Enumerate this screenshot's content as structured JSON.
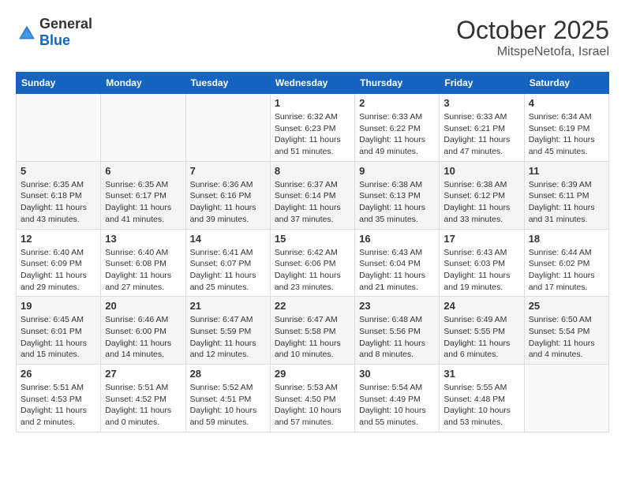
{
  "header": {
    "logo_general": "General",
    "logo_blue": "Blue",
    "month": "October 2025",
    "location": "MitspeNetofa, Israel"
  },
  "weekdays": [
    "Sunday",
    "Monday",
    "Tuesday",
    "Wednesday",
    "Thursday",
    "Friday",
    "Saturday"
  ],
  "weeks": [
    [
      {
        "day": "",
        "info": ""
      },
      {
        "day": "",
        "info": ""
      },
      {
        "day": "",
        "info": ""
      },
      {
        "day": "1",
        "info": "Sunrise: 6:32 AM\nSunset: 6:23 PM\nDaylight: 11 hours and 51 minutes."
      },
      {
        "day": "2",
        "info": "Sunrise: 6:33 AM\nSunset: 6:22 PM\nDaylight: 11 hours and 49 minutes."
      },
      {
        "day": "3",
        "info": "Sunrise: 6:33 AM\nSunset: 6:21 PM\nDaylight: 11 hours and 47 minutes."
      },
      {
        "day": "4",
        "info": "Sunrise: 6:34 AM\nSunset: 6:19 PM\nDaylight: 11 hours and 45 minutes."
      }
    ],
    [
      {
        "day": "5",
        "info": "Sunrise: 6:35 AM\nSunset: 6:18 PM\nDaylight: 11 hours and 43 minutes."
      },
      {
        "day": "6",
        "info": "Sunrise: 6:35 AM\nSunset: 6:17 PM\nDaylight: 11 hours and 41 minutes."
      },
      {
        "day": "7",
        "info": "Sunrise: 6:36 AM\nSunset: 6:16 PM\nDaylight: 11 hours and 39 minutes."
      },
      {
        "day": "8",
        "info": "Sunrise: 6:37 AM\nSunset: 6:14 PM\nDaylight: 11 hours and 37 minutes."
      },
      {
        "day": "9",
        "info": "Sunrise: 6:38 AM\nSunset: 6:13 PM\nDaylight: 11 hours and 35 minutes."
      },
      {
        "day": "10",
        "info": "Sunrise: 6:38 AM\nSunset: 6:12 PM\nDaylight: 11 hours and 33 minutes."
      },
      {
        "day": "11",
        "info": "Sunrise: 6:39 AM\nSunset: 6:11 PM\nDaylight: 11 hours and 31 minutes."
      }
    ],
    [
      {
        "day": "12",
        "info": "Sunrise: 6:40 AM\nSunset: 6:09 PM\nDaylight: 11 hours and 29 minutes."
      },
      {
        "day": "13",
        "info": "Sunrise: 6:40 AM\nSunset: 6:08 PM\nDaylight: 11 hours and 27 minutes."
      },
      {
        "day": "14",
        "info": "Sunrise: 6:41 AM\nSunset: 6:07 PM\nDaylight: 11 hours and 25 minutes."
      },
      {
        "day": "15",
        "info": "Sunrise: 6:42 AM\nSunset: 6:06 PM\nDaylight: 11 hours and 23 minutes."
      },
      {
        "day": "16",
        "info": "Sunrise: 6:43 AM\nSunset: 6:04 PM\nDaylight: 11 hours and 21 minutes."
      },
      {
        "day": "17",
        "info": "Sunrise: 6:43 AM\nSunset: 6:03 PM\nDaylight: 11 hours and 19 minutes."
      },
      {
        "day": "18",
        "info": "Sunrise: 6:44 AM\nSunset: 6:02 PM\nDaylight: 11 hours and 17 minutes."
      }
    ],
    [
      {
        "day": "19",
        "info": "Sunrise: 6:45 AM\nSunset: 6:01 PM\nDaylight: 11 hours and 15 minutes."
      },
      {
        "day": "20",
        "info": "Sunrise: 6:46 AM\nSunset: 6:00 PM\nDaylight: 11 hours and 14 minutes."
      },
      {
        "day": "21",
        "info": "Sunrise: 6:47 AM\nSunset: 5:59 PM\nDaylight: 11 hours and 12 minutes."
      },
      {
        "day": "22",
        "info": "Sunrise: 6:47 AM\nSunset: 5:58 PM\nDaylight: 11 hours and 10 minutes."
      },
      {
        "day": "23",
        "info": "Sunrise: 6:48 AM\nSunset: 5:56 PM\nDaylight: 11 hours and 8 minutes."
      },
      {
        "day": "24",
        "info": "Sunrise: 6:49 AM\nSunset: 5:55 PM\nDaylight: 11 hours and 6 minutes."
      },
      {
        "day": "25",
        "info": "Sunrise: 6:50 AM\nSunset: 5:54 PM\nDaylight: 11 hours and 4 minutes."
      }
    ],
    [
      {
        "day": "26",
        "info": "Sunrise: 5:51 AM\nSunset: 4:53 PM\nDaylight: 11 hours and 2 minutes."
      },
      {
        "day": "27",
        "info": "Sunrise: 5:51 AM\nSunset: 4:52 PM\nDaylight: 11 hours and 0 minutes."
      },
      {
        "day": "28",
        "info": "Sunrise: 5:52 AM\nSunset: 4:51 PM\nDaylight: 10 hours and 59 minutes."
      },
      {
        "day": "29",
        "info": "Sunrise: 5:53 AM\nSunset: 4:50 PM\nDaylight: 10 hours and 57 minutes."
      },
      {
        "day": "30",
        "info": "Sunrise: 5:54 AM\nSunset: 4:49 PM\nDaylight: 10 hours and 55 minutes."
      },
      {
        "day": "31",
        "info": "Sunrise: 5:55 AM\nSunset: 4:48 PM\nDaylight: 10 hours and 53 minutes."
      },
      {
        "day": "",
        "info": ""
      }
    ]
  ]
}
